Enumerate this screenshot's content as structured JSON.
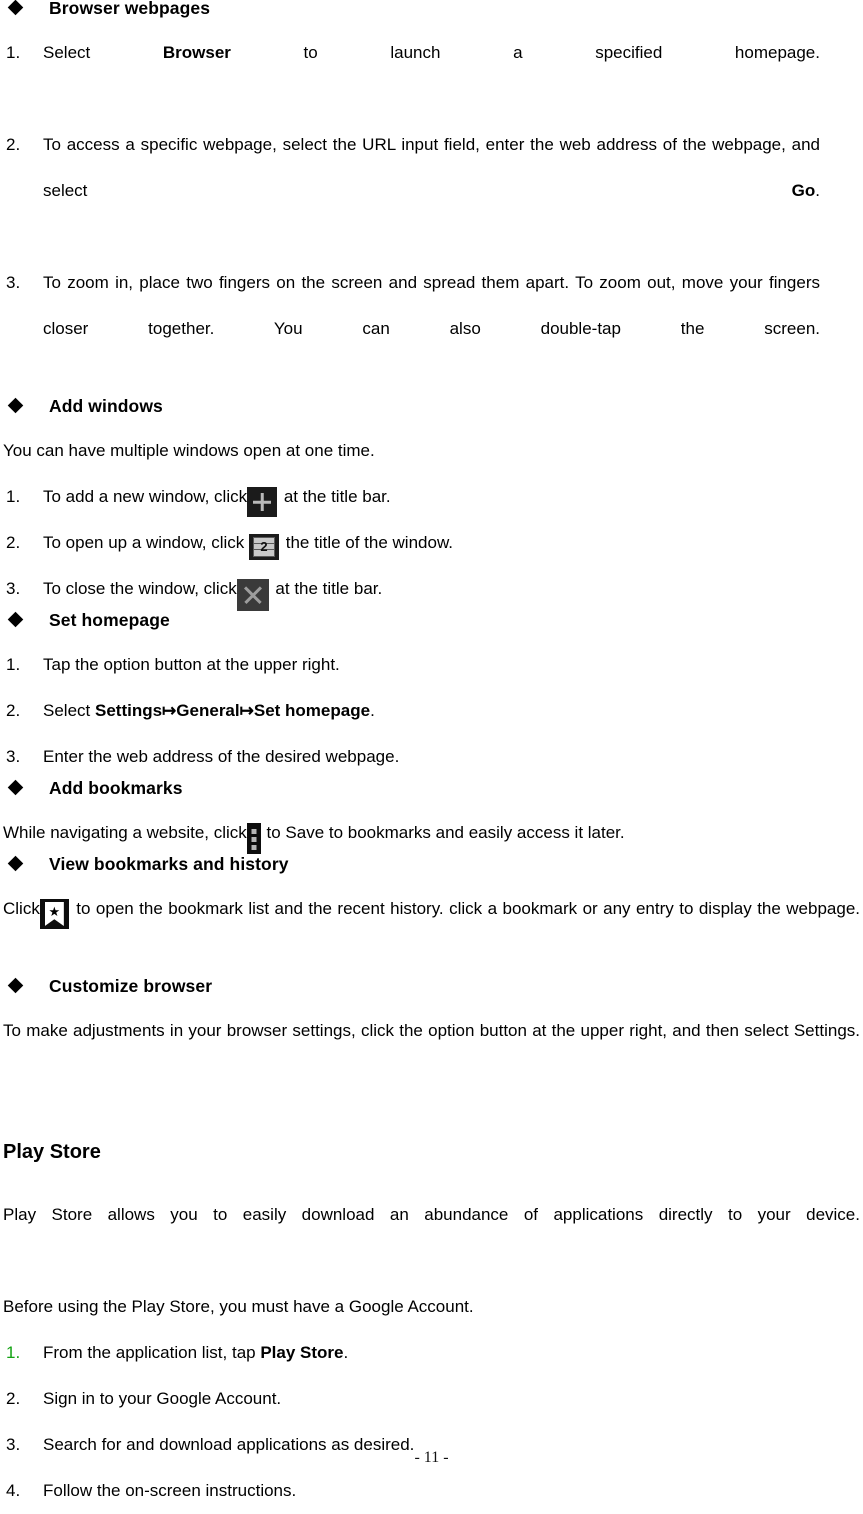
{
  "document": {
    "page_footer": "- 11 -"
  },
  "sections": [
    {
      "heading": "Browser webpages",
      "bullet_icon": "diamond-icon",
      "items": [
        {
          "num": "1.",
          "before": "Select ",
          "bold": "Browser",
          "after": " to launch a specified homepage."
        },
        {
          "num": "2.",
          "before": "To access a specific webpage, select the URL input field, enter the web address of the webpage, and select ",
          "bold": "Go",
          "after": "."
        },
        {
          "num": "3.",
          "before": "To zoom in, place two fingers on the screen and spread them apart. To zoom out, move your fingers closer together. You can also double-tap the screen.",
          "bold": "",
          "after": ""
        }
      ]
    },
    {
      "heading": "Add windows",
      "bullet_icon": "diamond-icon",
      "intro": "You can have multiple windows open at one time.",
      "items": [
        {
          "num": "1.",
          "before": "To add a new window, click",
          "icon": "plus-icon",
          "after": "  at the title bar."
        },
        {
          "num": "2.",
          "before": "To open up a window, click ",
          "icon": "windows-count-icon",
          "icon_count": "2",
          "after": " the title of the window."
        },
        {
          "num": "3.",
          "before": "To close the window, click",
          "icon": "close-x-icon",
          "after": " at the title bar."
        }
      ]
    },
    {
      "heading": "Set homepage",
      "bullet_icon": "diamond-icon",
      "items": [
        {
          "num": "1.",
          "before": "Tap the option button at the upper right.",
          "bold": "",
          "after": ""
        },
        {
          "num": "2.",
          "before": "Select ",
          "path": [
            "Settings",
            "General",
            "Set homepage"
          ],
          "arrow": "↦",
          "after": "."
        },
        {
          "num": "3.",
          "before": "Enter the web address of the desired webpage.",
          "bold": "",
          "after": ""
        }
      ]
    },
    {
      "heading": "Add bookmarks",
      "bullet_icon": "diamond-icon",
      "body_before": "While navigating a website, click",
      "body_icon": "overflow-menu-icon",
      "body_after": "  to Save to bookmarks and easily access it later."
    },
    {
      "heading": "View bookmarks and history",
      "bullet_icon": "diamond-icon",
      "body_before": "Click",
      "body_icon": "bookmark-star-icon",
      "body_after": "  to open the bookmark list and the recent history. click a bookmark or any entry to display the webpage."
    },
    {
      "heading": "Customize browser",
      "bullet_icon": "diamond-icon",
      "body": "To make adjustments in your browser settings, click the option button at the upper right, and then select Settings."
    }
  ],
  "play_store": {
    "title": "Play Store",
    "intro_line1": "Play Store allows you to easily download an abundance of applications directly to your device.",
    "intro_line2": "Before using the Play Store, you must have a Google Account.",
    "accent_color": "#13A313",
    "items": [
      {
        "num": "1.",
        "num_color": "green",
        "before": "From the application list, tap ",
        "bold": "Play Store",
        "after": "."
      },
      {
        "num": "2.",
        "num_color": "black",
        "before": "Sign in to your Google Account.",
        "bold": "",
        "after": ""
      },
      {
        "num": "3.",
        "num_color": "black",
        "before": "Search for and download applications as desired.",
        "bold": "",
        "after": ""
      },
      {
        "num": "4.",
        "num_color": "black",
        "before": "Follow the on-screen instructions.",
        "bold": "",
        "after": ""
      }
    ]
  }
}
